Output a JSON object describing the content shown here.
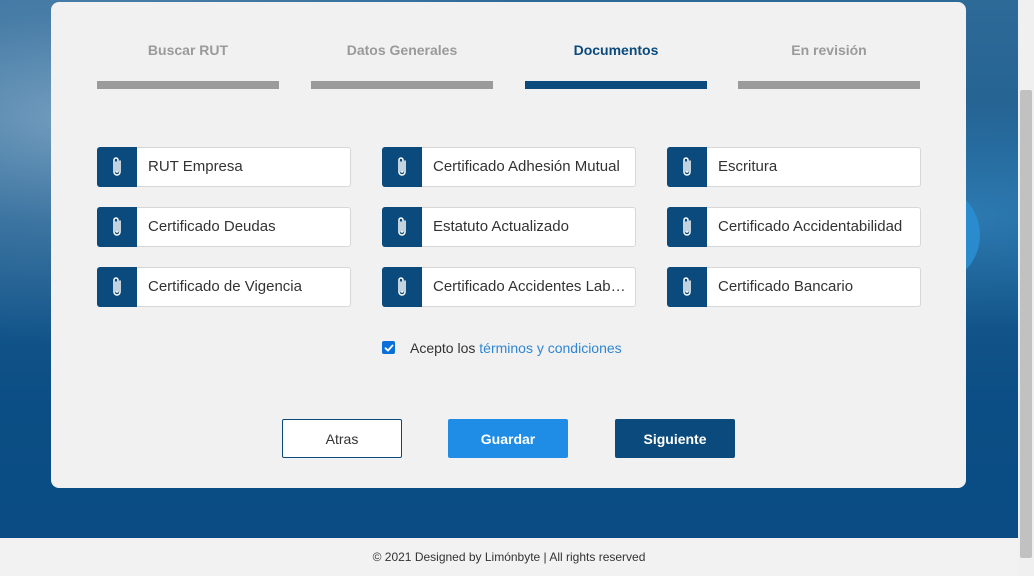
{
  "colors": {
    "primary": "#0b4a7c",
    "accent": "#1f8de6",
    "link": "#2f86d3",
    "inactive_step": "#9b9b9b"
  },
  "steps": [
    {
      "label": "Buscar RUT",
      "active": false
    },
    {
      "label": "Datos Generales",
      "active": false
    },
    {
      "label": "Documentos",
      "active": true
    },
    {
      "label": "En revisión",
      "active": false
    }
  ],
  "documents": [
    {
      "label": "RUT Empresa",
      "icon": "paperclip-icon"
    },
    {
      "label": "Certificado Adhesión Mutual",
      "icon": "paperclip-icon"
    },
    {
      "label": "Escritura",
      "icon": "paperclip-icon"
    },
    {
      "label": "Certificado Deudas",
      "icon": "paperclip-icon"
    },
    {
      "label": "Estatuto Actualizado",
      "icon": "paperclip-icon"
    },
    {
      "label": "Certificado Accidentabilidad",
      "icon": "paperclip-icon"
    },
    {
      "label": "Certificado de Vigencia",
      "icon": "paperclip-icon"
    },
    {
      "label": "Certificado Accidentes Laborales",
      "icon": "paperclip-icon"
    },
    {
      "label": "Certificado Bancario",
      "icon": "paperclip-icon"
    }
  ],
  "terms": {
    "prefix": "Acepto los ",
    "link_text": "términos y condiciones",
    "checked": true
  },
  "buttons": {
    "back": "Atras",
    "save": "Guardar",
    "next": "Siguiente"
  },
  "footer": {
    "text": "© 2021 Designed by Limónbyte | All rights reserved"
  }
}
